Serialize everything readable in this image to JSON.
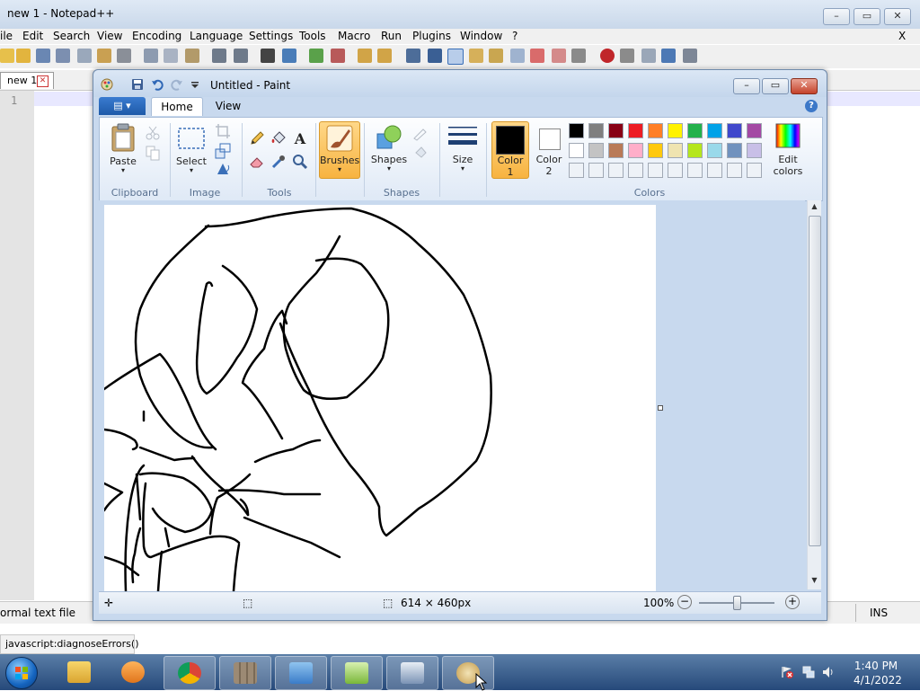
{
  "notepadpp": {
    "title": "new 1 - Notepad++",
    "menu": [
      "ile",
      "Edit",
      "Search",
      "View",
      "Encoding",
      "Language",
      "Settings",
      "Tools",
      "Macro",
      "Run",
      "Plugins",
      "Window",
      "?"
    ],
    "menu_close": "X",
    "tab_label": "new 1",
    "line_number": "1",
    "status_left": "ormal text file",
    "status_right": "INS"
  },
  "browser_status": "javascript:diagnoseErrors()",
  "paint": {
    "title": "Untitled - Paint",
    "tabs": {
      "home": "Home",
      "view": "View"
    },
    "groups": {
      "clipboard": "Clipboard",
      "image": "Image",
      "tools": "Tools",
      "shapes": "Shapes",
      "colors": "Colors"
    },
    "buttons": {
      "paste": "Paste",
      "select": "Select",
      "brushes": "Brushes",
      "shapes": "Shapes",
      "size": "Size",
      "color1_line1": "Color",
      "color1_line2": "1",
      "color2_line1": "Color",
      "color2_line2": "2",
      "edit_colors_line1": "Edit",
      "edit_colors_line2": "colors"
    },
    "palette_row1": [
      "#000000",
      "#7f7f7f",
      "#880015",
      "#ed1c24",
      "#ff7f27",
      "#fff200",
      "#22b14c",
      "#00a2e8",
      "#3f48cc",
      "#a349a4"
    ],
    "palette_row2": [
      "#ffffff",
      "#c3c3c3",
      "#b97a57",
      "#ffaec9",
      "#ffc90e",
      "#efe4b0",
      "#b5e61d",
      "#99d9ea",
      "#7092be",
      "#c8bfe7"
    ],
    "color1": "#000000",
    "color2": "#ffffff",
    "status": {
      "canvas_size": "614 × 460px",
      "zoom": "100%"
    }
  },
  "taskbar": {
    "time": "1:40 PM",
    "date": "4/1/2022"
  }
}
